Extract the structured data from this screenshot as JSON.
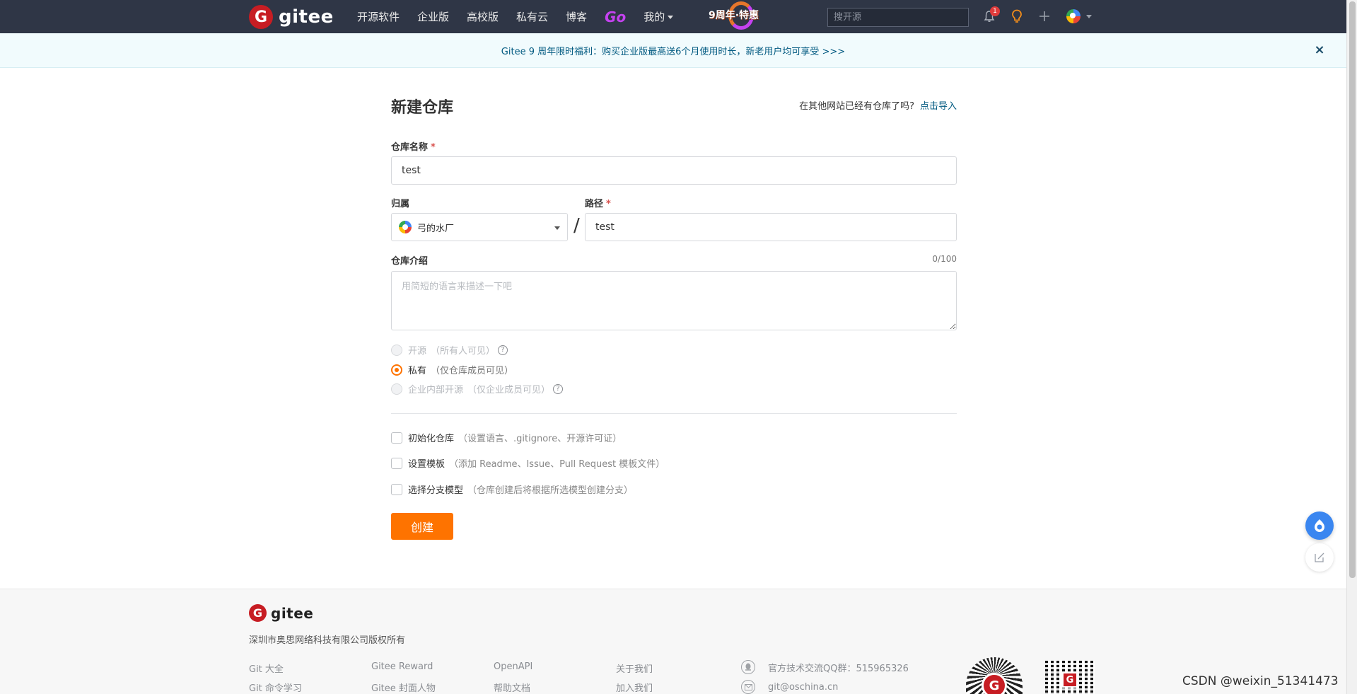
{
  "nav": {
    "logo_text": "gitee",
    "items": [
      "开源软件",
      "企业版",
      "高校版",
      "私有云",
      "博客"
    ],
    "go_label": "Go",
    "mine_label": "我的",
    "anniversary_label": "9周年·特惠",
    "search_placeholder": "搜开源",
    "notification_count": "1",
    "icons": [
      "bell-icon",
      "lightbulb-icon",
      "plus-icon",
      "avatar"
    ]
  },
  "announcement": {
    "text": "Gitee 9 周年限时福利：购买企业版最高送6个月使用时长，新老用户均可享受 >>>",
    "close_symbol": "×"
  },
  "form": {
    "title": "新建仓库",
    "import_hint": "在其他网站已经有仓库了吗?",
    "import_link": "点击导入",
    "repo_name_label": "仓库名称",
    "required_mark": "*",
    "repo_name_value": "test",
    "owner_label": "归属",
    "owner_value": "弓的水厂",
    "slash": "/",
    "path_label": "路径",
    "path_value": "test",
    "description_label": "仓库介绍",
    "description_counter": "0/100",
    "description_placeholder": "用简短的语言来描述一下吧",
    "visibility": [
      {
        "label": "开源",
        "hint": "（所有人可见）",
        "selected": false,
        "help": true
      },
      {
        "label": "私有",
        "hint": "（仅仓库成员可见）",
        "selected": true,
        "help": false
      },
      {
        "label": "企业内部开源",
        "hint": "（仅企业成员可见）",
        "selected": false,
        "help": true
      }
    ],
    "options": [
      {
        "label": "初始化仓库",
        "hint": "（设置语言、.gitignore、开源许可证）"
      },
      {
        "label": "设置模板",
        "hint": "（添加 Readme、Issue、Pull Request 模板文件）"
      },
      {
        "label": "选择分支模型",
        "hint": "（仓库创建后将根据所选模型创建分支）"
      }
    ],
    "create_label": "创建"
  },
  "footer": {
    "logo_text": "gitee",
    "copyright": "深圳市奥思网络科技有限公司版权所有",
    "links": [
      [
        "Git 大全",
        "Git 命令学习"
      ],
      [
        "Gitee Reward",
        "Gitee 封面人物"
      ],
      [
        "OpenAPI",
        "帮助文档"
      ],
      [
        "关于我们",
        "加入我们"
      ]
    ],
    "qq_group": "官方技术交流QQ群：515965326",
    "email": "git@oschina.cn"
  },
  "watermark": "CSDN @weixin_51341473",
  "colors": {
    "nav_bg": "#2f3646",
    "brand_red": "#c71d23",
    "accent_orange": "#fe7300",
    "link_blue": "#005980"
  }
}
